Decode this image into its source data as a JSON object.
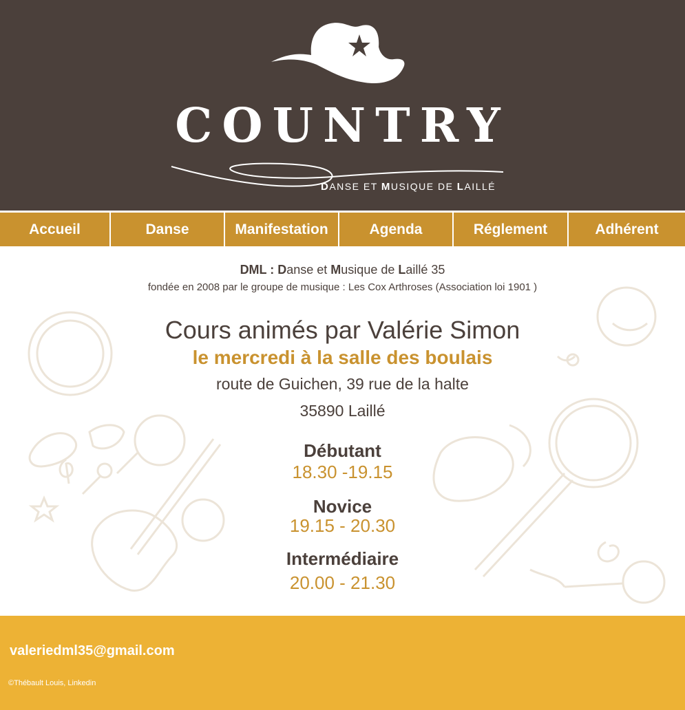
{
  "brand": {
    "title": "COUNTRY",
    "subtitle_parts": [
      {
        "cap": "D",
        "rest": "ANSE ET "
      },
      {
        "cap": "M",
        "rest": "USIQUE DE "
      },
      {
        "cap": "L",
        "rest": "AILLÉ"
      }
    ]
  },
  "nav": {
    "items": [
      {
        "label": "Accueil"
      },
      {
        "label": "Danse"
      },
      {
        "label": "Manifestation"
      },
      {
        "label": "Agenda"
      },
      {
        "label": "Réglement"
      },
      {
        "label": "Adhérent"
      }
    ]
  },
  "intro": {
    "dml": "DML :",
    "d": "D",
    "anse": "anse et ",
    "m": "M",
    "usique": "usique de ",
    "l": "L",
    "aille": "aillé 35",
    "founded": "fondée en 2008 par le groupe de musique : Les Cox Arthroses (Association loi 1901 )"
  },
  "cours": {
    "teacher": "Cours animés par Valérie Simon",
    "when_where": "le mercredi à la salle des boulais",
    "address1": "route de Guichen, 39 rue de la halte",
    "address2": "35890 Laillé"
  },
  "levels": [
    {
      "name": "Débutant",
      "time": "18.30 -19.15"
    },
    {
      "name": "Novice",
      "time": "19.15 - 20.30"
    },
    {
      "name": "Intermédiaire",
      "time": "20.00 - 21.30"
    }
  ],
  "footer": {
    "email": "valeriedml35@gmail.com",
    "credit": "©Thébault Louis, Linkedin"
  },
  "colors": {
    "header_bg": "#4b403b",
    "nav_bg": "#c9922f",
    "accent": "#c9922f",
    "footer_bg": "#edb235",
    "text_dark": "#4b403b"
  },
  "icons": [
    "cowboy-hat-icon",
    "lasso-icon",
    "tambourine-icon",
    "banjo-icon",
    "guitar-icon",
    "hat-icon",
    "bandana-icon",
    "microphone-icon",
    "music-note-icon",
    "treble-clef-icon",
    "star-icon"
  ]
}
